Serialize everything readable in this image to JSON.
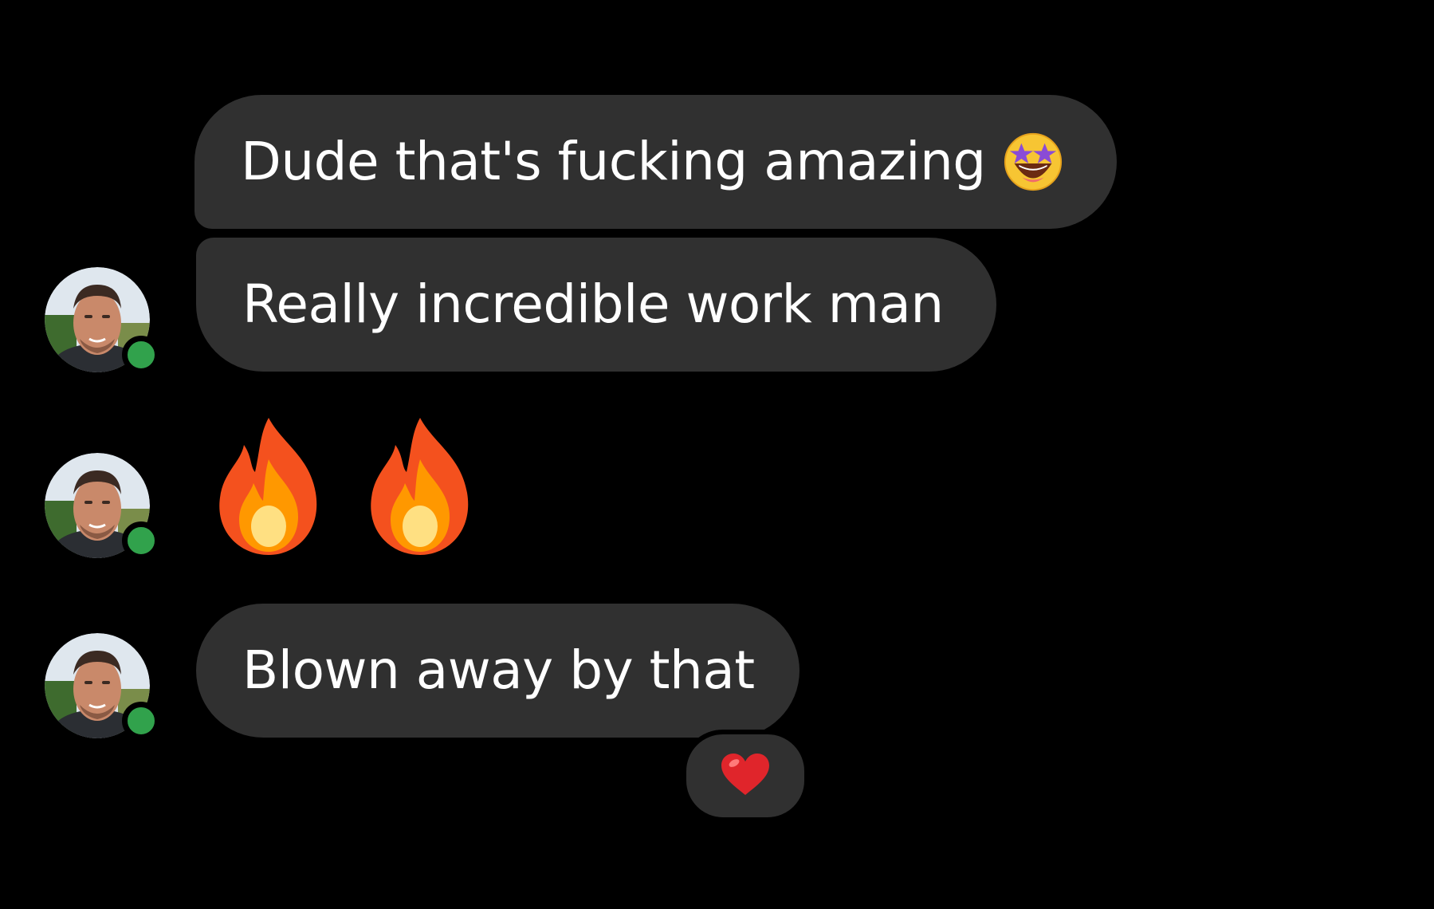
{
  "colors": {
    "background": "#000000",
    "bubble": "#303030",
    "text": "#ffffff",
    "online_status": "#31a24c",
    "heart": "#e0252b"
  },
  "messages": [
    {
      "text": "Dude that's fucking amazing",
      "trailing_emoji": "star-struck-icon"
    },
    {
      "text": "Really incredible work man"
    },
    {
      "emojis": [
        "fire-icon",
        "fire-icon"
      ]
    },
    {
      "text": "Blown away by that",
      "reaction": "heart-icon"
    }
  ],
  "sender": {
    "online": true,
    "avatar": "profile-photo"
  }
}
